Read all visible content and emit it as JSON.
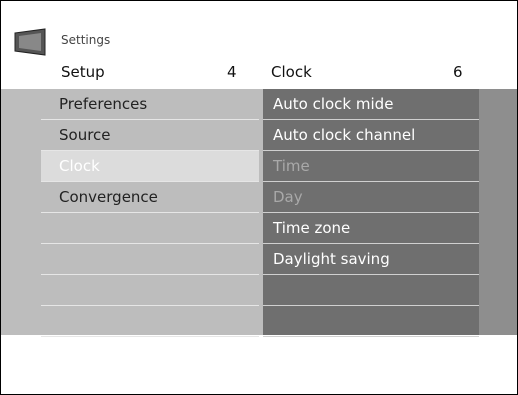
{
  "header": {
    "breadcrumb": "Settings",
    "left_title": "Setup",
    "left_count": "4",
    "right_title": "Clock",
    "right_count": "6"
  },
  "left_menu": [
    "Preferences",
    "Source",
    "Clock",
    "Convergence"
  ],
  "right_menu": [
    "Auto clock mide",
    "Auto clock channel",
    "Time",
    "Day",
    "Time zone",
    "Daylight saving"
  ],
  "selected_left": "Clock",
  "dimmed_right": [
    "Time",
    "Day"
  ]
}
